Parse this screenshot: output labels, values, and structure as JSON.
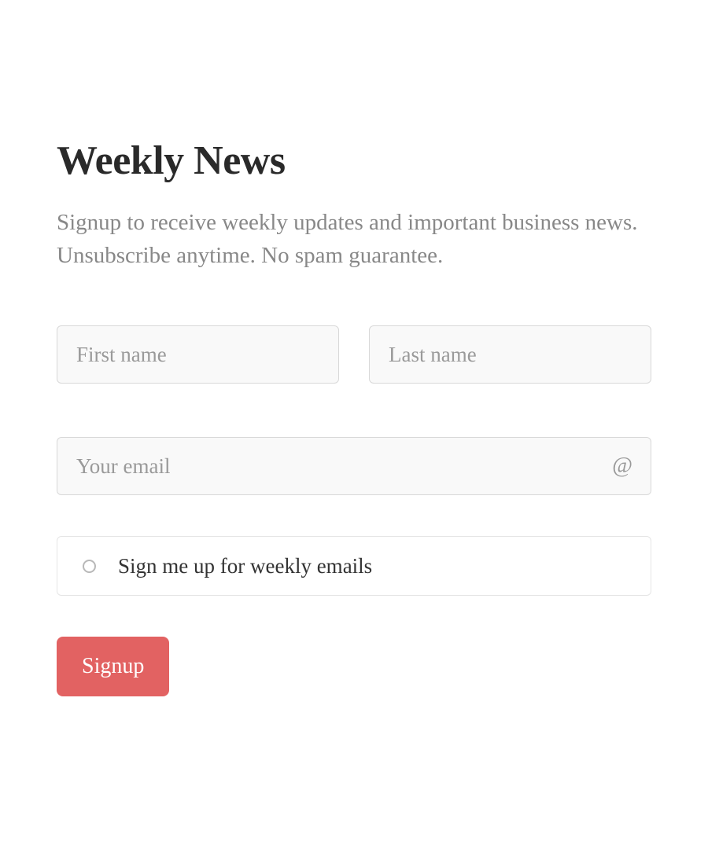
{
  "heading": "Weekly News",
  "description": "Signup to receive weekly updates and important business news. Unsubscribe anytime. No spam guarantee.",
  "form": {
    "first_name": {
      "placeholder": "First name",
      "value": ""
    },
    "last_name": {
      "placeholder": "Last name",
      "value": ""
    },
    "email": {
      "placeholder": "Your email",
      "value": ""
    },
    "subscribe_label": "Sign me up for weekly emails",
    "subscribe_checked": false,
    "submit_label": "Signup"
  }
}
